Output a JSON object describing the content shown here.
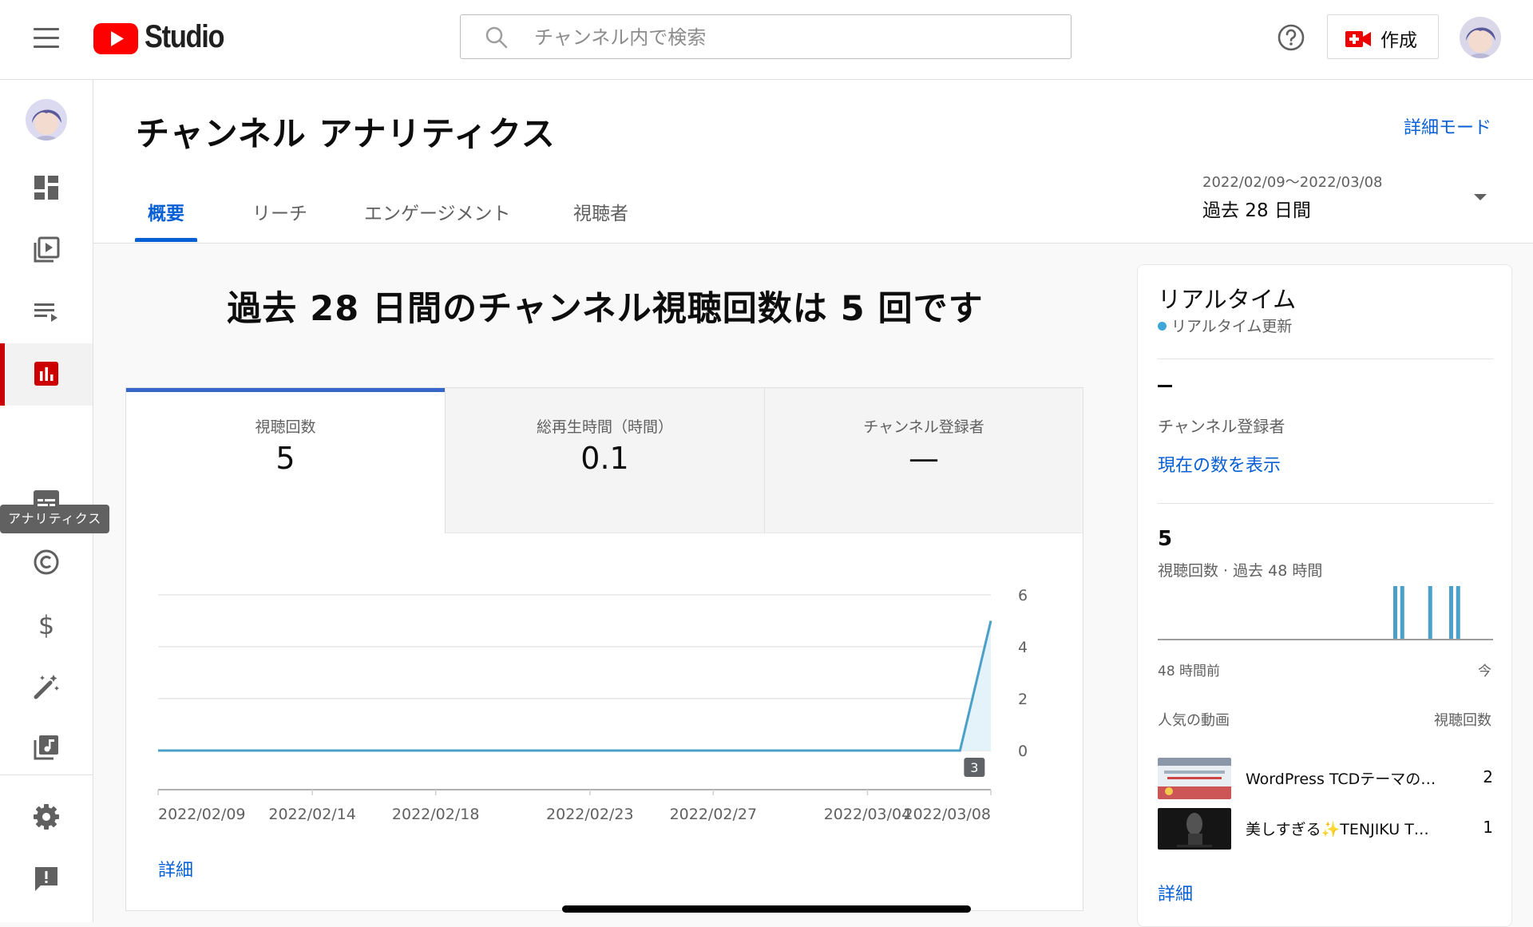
{
  "app": {
    "logo_text": "Studio",
    "search_placeholder": "チャンネル内で検索",
    "create_label": "作成"
  },
  "sidebar": {
    "items": [
      {
        "name": "dashboard",
        "icon": "dashboard-icon"
      },
      {
        "name": "content",
        "icon": "video-library-icon"
      },
      {
        "name": "playlists",
        "icon": "playlist-icon"
      },
      {
        "name": "analytics",
        "icon": "analytics-icon",
        "active": true
      },
      {
        "name": "subtitles",
        "icon": "subtitles-icon"
      },
      {
        "name": "copyright",
        "icon": "copyright-icon"
      },
      {
        "name": "monetization",
        "icon": "dollar-icon"
      },
      {
        "name": "customization",
        "icon": "magic-wand-icon"
      },
      {
        "name": "audio-library",
        "icon": "audio-library-icon"
      },
      {
        "name": "settings",
        "icon": "gear-icon"
      },
      {
        "name": "feedback",
        "icon": "feedback-icon"
      }
    ],
    "tooltip": "アナリティクス"
  },
  "header": {
    "title": "チャンネル アナリティクス",
    "advanced_mode": "詳細モード",
    "tabs": [
      "概要",
      "リーチ",
      "エンゲージメント",
      "視聴者"
    ],
    "active_tab": 0,
    "date_range": "2022/02/09〜2022/03/08",
    "date_label": "過去 28 日間"
  },
  "main": {
    "headline": "過去 28 日間のチャンネル視聴回数は 5 回です",
    "metrics": [
      {
        "label": "視聴回数",
        "value": "5"
      },
      {
        "label": "総再生時間（時間）",
        "value": "0.1"
      },
      {
        "label": "チャンネル登録者",
        "value": "—"
      }
    ],
    "detail_link": "詳細"
  },
  "chart_data": {
    "type": "line",
    "x": [
      "2022/02/09",
      "2022/02/10",
      "2022/02/11",
      "2022/02/12",
      "2022/02/13",
      "2022/02/14",
      "2022/02/15",
      "2022/02/16",
      "2022/02/17",
      "2022/02/18",
      "2022/02/19",
      "2022/02/20",
      "2022/02/21",
      "2022/02/22",
      "2022/02/23",
      "2022/02/24",
      "2022/02/25",
      "2022/02/26",
      "2022/02/27",
      "2022/02/28",
      "2022/03/01",
      "2022/03/02",
      "2022/03/03",
      "2022/03/04",
      "2022/03/05",
      "2022/03/06",
      "2022/03/07",
      "2022/03/08"
    ],
    "values": [
      0,
      0,
      0,
      0,
      0,
      0,
      0,
      0,
      0,
      0,
      0,
      0,
      0,
      0,
      0,
      0,
      0,
      0,
      0,
      0,
      0,
      0,
      0,
      0,
      0,
      0,
      0,
      5
    ],
    "tick_labels": [
      "2022/02/09",
      "2022/02/14",
      "2022/02/18",
      "2022/02/23",
      "2022/02/27",
      "2022/03/04",
      "2022/03/08"
    ],
    "y_ticks": [
      "0",
      "2",
      "4",
      "6"
    ],
    "ylim": [
      0,
      6
    ],
    "annotation": "3",
    "grid": true
  },
  "realtime": {
    "title": "リアルタイム",
    "subtitle": "リアルタイム更新",
    "subscribers_value": "—",
    "subscribers_label": "チャンネル登録者",
    "show_count_link": "現在の数を表示",
    "views_value": "5",
    "views_label": "視聴回数 · 過去 48 時間",
    "spark_range": [
      "48 時間前",
      "今"
    ],
    "spark_bars": [
      {
        "hour": 34,
        "views": 1
      },
      {
        "hour": 35,
        "views": 1
      },
      {
        "hour": 39,
        "views": 1
      },
      {
        "hour": 42,
        "views": 1
      },
      {
        "hour": 43,
        "views": 1
      }
    ],
    "top_videos_header": "人気の動画",
    "views_header": "視聴回数",
    "videos": [
      {
        "title": "WordPress TCDテーマの…",
        "views": "2"
      },
      {
        "title": "美しすぎる✨TENJIKU T…",
        "views": "1"
      }
    ],
    "detail_link": "詳細"
  },
  "colors": {
    "accent_blue": "#065fd4",
    "brand_red": "#ff0000",
    "chart_line": "#4aa0c8",
    "metric_bar": "#3666c9"
  }
}
